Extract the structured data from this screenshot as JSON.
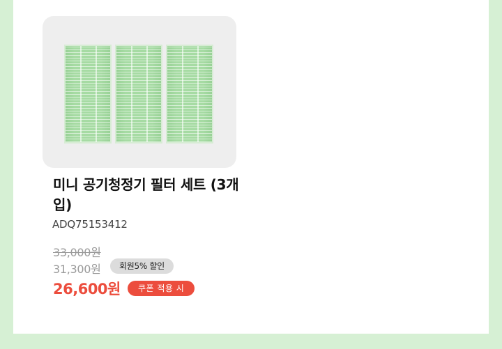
{
  "product": {
    "name": "미니 공기청정기 필터 세트 (3개입)",
    "model": "ADQ75153412",
    "image_alt": "three green filter panels"
  },
  "pricing": {
    "original_price": "33,000원",
    "member_price": "31,300원",
    "member_badge": "회원5% 할인",
    "coupon_price": "26,600원",
    "coupon_badge": "쿠폰 적용 시"
  },
  "colors": {
    "background": "#d6f0d4",
    "accent_red": "#ec4d3d",
    "badge_gray": "#dcdcdc"
  }
}
